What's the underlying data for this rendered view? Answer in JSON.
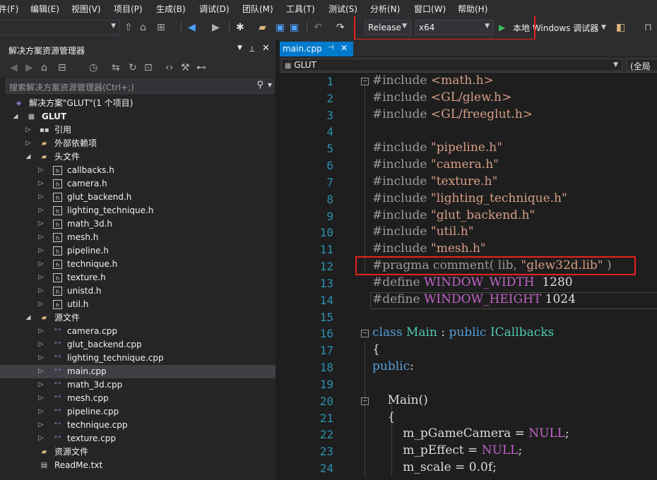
{
  "menu": {
    "items": [
      "件(F)",
      "编辑(E)",
      "视图(V)",
      "项目(P)",
      "生成(B)",
      "调试(D)",
      "团队(M)",
      "工具(T)",
      "测试(S)",
      "分析(N)",
      "窗口(W)",
      "帮助(H)"
    ]
  },
  "toolbar": {
    "configuration": "Release",
    "platform": "x64",
    "run_label": "本地 Windows 调试器"
  },
  "solution_explorer": {
    "title": "解决方案资源管理器",
    "search_placeholder": "搜索解决方案资源管理器(Ctrl+;)",
    "solution": "解决方案\"GLUT\"(1 个项目)",
    "project": "GLUT",
    "references": "引用",
    "external_deps": "外部依赖项",
    "headers_folder": "头文件",
    "headers": [
      "callbacks.h",
      "camera.h",
      "glut_backend.h",
      "lighting_technique.h",
      "math_3d.h",
      "mesh.h",
      "pipeline.h",
      "technique.h",
      "texture.h",
      "unistd.h",
      "util.h"
    ],
    "sources_folder": "源文件",
    "sources": [
      "camera.cpp",
      "glut_backend.cpp",
      "lighting_technique.cpp",
      "main.cpp",
      "math_3d.cpp",
      "mesh.cpp",
      "pipeline.cpp",
      "technique.cpp",
      "texture.cpp"
    ],
    "selected_source": "main.cpp",
    "resources_folder": "资源文件",
    "readme": "ReadMe.txt"
  },
  "editor": {
    "tab": "main.cpp",
    "scope": "GLUT",
    "scope_right": "(全局",
    "lines": [
      {
        "n": "1",
        "parts": [
          [
            "pre",
            "#include "
          ],
          [
            "s",
            "<math.h>"
          ]
        ]
      },
      {
        "n": "2",
        "parts": [
          [
            "pre",
            "#include "
          ],
          [
            "s",
            "<GL/glew.h>"
          ]
        ]
      },
      {
        "n": "3",
        "parts": [
          [
            "pre",
            "#include "
          ],
          [
            "s",
            "<GL/freeglut.h>"
          ]
        ]
      },
      {
        "n": "4",
        "parts": []
      },
      {
        "n": "5",
        "parts": [
          [
            "pre",
            "#include "
          ],
          [
            "s",
            "\"pipeline.h\""
          ]
        ]
      },
      {
        "n": "6",
        "parts": [
          [
            "pre",
            "#include "
          ],
          [
            "s",
            "\"camera.h\""
          ]
        ]
      },
      {
        "n": "7",
        "parts": [
          [
            "pre",
            "#include "
          ],
          [
            "s",
            "\"texture.h\""
          ]
        ]
      },
      {
        "n": "8",
        "parts": [
          [
            "pre",
            "#include "
          ],
          [
            "s",
            "\"lighting_technique.h\""
          ]
        ]
      },
      {
        "n": "9",
        "parts": [
          [
            "pre",
            "#include "
          ],
          [
            "s",
            "\"glut_backend.h\""
          ]
        ]
      },
      {
        "n": "10",
        "parts": [
          [
            "pre",
            "#include "
          ],
          [
            "s",
            "\"util.h\""
          ]
        ]
      },
      {
        "n": "11",
        "parts": [
          [
            "pre",
            "#include "
          ],
          [
            "s",
            "\"mesh.h\""
          ]
        ]
      },
      {
        "n": "12",
        "parts": [
          [
            "pre",
            "#pragma comment( lib, "
          ],
          [
            "s",
            "\"glew32d.lib\""
          ],
          [
            "pre",
            " )"
          ]
        ]
      },
      {
        "n": "13",
        "parts": [
          [
            "pre",
            "#define "
          ],
          [
            "m",
            "WINDOW_WIDTH"
          ],
          [
            "w",
            "  1280"
          ]
        ]
      },
      {
        "n": "14",
        "parts": [
          [
            "pre",
            "#define "
          ],
          [
            "m",
            "WINDOW_HEIGHT"
          ],
          [
            "w",
            " 1024"
          ]
        ]
      },
      {
        "n": "15",
        "parts": []
      },
      {
        "n": "16",
        "parts": [
          [
            "k",
            "class "
          ],
          [
            "t",
            "Main"
          ],
          [
            "w",
            " : "
          ],
          [
            "k",
            "public "
          ],
          [
            "t",
            "ICallbacks"
          ]
        ]
      },
      {
        "n": "17",
        "parts": [
          [
            "w",
            "{"
          ]
        ]
      },
      {
        "n": "18",
        "parts": [
          [
            "k",
            "public"
          ],
          [
            "w",
            ":"
          ]
        ]
      },
      {
        "n": "19",
        "parts": []
      },
      {
        "n": "20",
        "parts": [
          [
            "w",
            "    Main()"
          ]
        ]
      },
      {
        "n": "21",
        "parts": [
          [
            "w",
            "    {"
          ]
        ]
      },
      {
        "n": "22",
        "parts": [
          [
            "w",
            "        m_pGameCamera = "
          ],
          [
            "m",
            "NULL"
          ],
          [
            "w",
            ";"
          ]
        ]
      },
      {
        "n": "23",
        "parts": [
          [
            "w",
            "        m_pEffect = "
          ],
          [
            "m",
            "NULL"
          ],
          [
            "w",
            ";"
          ]
        ]
      },
      {
        "n": "24",
        "parts": [
          [
            "w",
            "        m_scale = 0.0f;"
          ]
        ]
      }
    ]
  }
}
